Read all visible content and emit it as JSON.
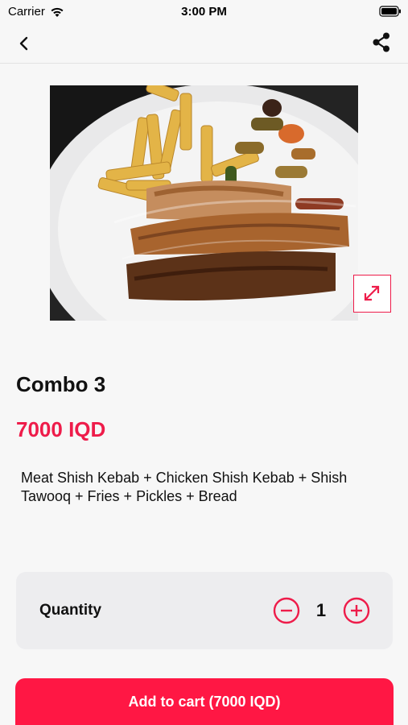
{
  "status_bar": {
    "carrier": "Carrier",
    "time": "3:00 PM"
  },
  "nav": {
    "back_icon": "chevron-left-icon",
    "share_icon": "share-icon"
  },
  "product": {
    "image_alt": "Combo 3 plate",
    "name": "Combo 3",
    "price": "7000 IQD",
    "description": "Meat Shish Kebab + Chicken Shish Kebab + Shish Tawooq + Fries + Pickles + Bread"
  },
  "quantity": {
    "label": "Quantity",
    "value": "1"
  },
  "cart_button": {
    "label": "Add to cart (7000 IQD)"
  },
  "colors": {
    "accent": "#ee1c4a",
    "button": "#ff1744",
    "card": "#ededef",
    "background": "#f7f7f7"
  }
}
